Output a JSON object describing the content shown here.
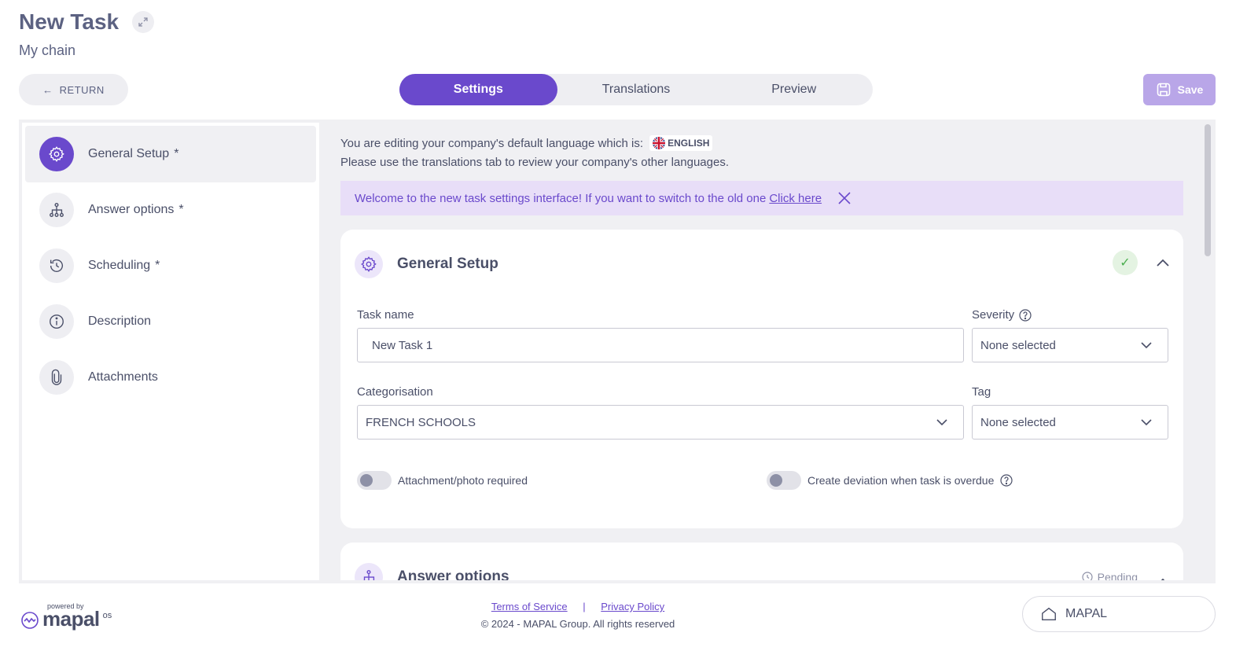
{
  "header": {
    "title": "New Task",
    "subtitle": "My chain",
    "return_label": "RETURN",
    "save_label": "Save"
  },
  "tabs": [
    {
      "label": "Settings",
      "active": true
    },
    {
      "label": "Translations",
      "active": false
    },
    {
      "label": "Preview",
      "active": false
    }
  ],
  "sidebar": {
    "items": [
      {
        "label": "General Setup",
        "required": "*",
        "icon": "gear-icon",
        "active": true
      },
      {
        "label": "Answer options",
        "required": "*",
        "icon": "hierarchy-icon",
        "active": false
      },
      {
        "label": "Scheduling",
        "required": "*",
        "icon": "history-icon",
        "active": false
      },
      {
        "label": "Description",
        "required": "",
        "icon": "info-icon",
        "active": false
      },
      {
        "label": "Attachments",
        "required": "",
        "icon": "paperclip-icon",
        "active": false
      }
    ]
  },
  "language_notice": {
    "line1": "You are editing your company's default language which is:",
    "language": "ENGLISH",
    "line2": "Please use the translations tab to review your company's other languages."
  },
  "banner": {
    "text": "Welcome to the new task settings interface! If you want to switch to the old one",
    "link": "Click here"
  },
  "general_setup": {
    "title": "General Setup",
    "task_name_label": "Task name",
    "task_name_value": "New Task 1",
    "severity_label": "Severity",
    "severity_value": "None selected",
    "categorisation_label": "Categorisation",
    "categorisation_value": "FRENCH SCHOOLS",
    "tag_label": "Tag",
    "tag_value": "None selected",
    "toggle_attachment_label": "Attachment/photo required",
    "toggle_deviation_label": "Create deviation when task is overdue"
  },
  "answer_options": {
    "title": "Answer options",
    "status": "Pending"
  },
  "footer": {
    "powered_by": "powered by",
    "logo_word": "mapal",
    "logo_suffix": "os",
    "terms": "Terms of Service",
    "separator": "|",
    "privacy": "Privacy Policy",
    "copyright": "© 2024 - MAPAL Group. All rights reserved",
    "mapal_button": "MAPAL"
  },
  "colors": {
    "accent": "#6a49cc",
    "save_disabled": "#b9a6e8",
    "banner_bg": "#e8def8",
    "success": "#4caf50"
  }
}
